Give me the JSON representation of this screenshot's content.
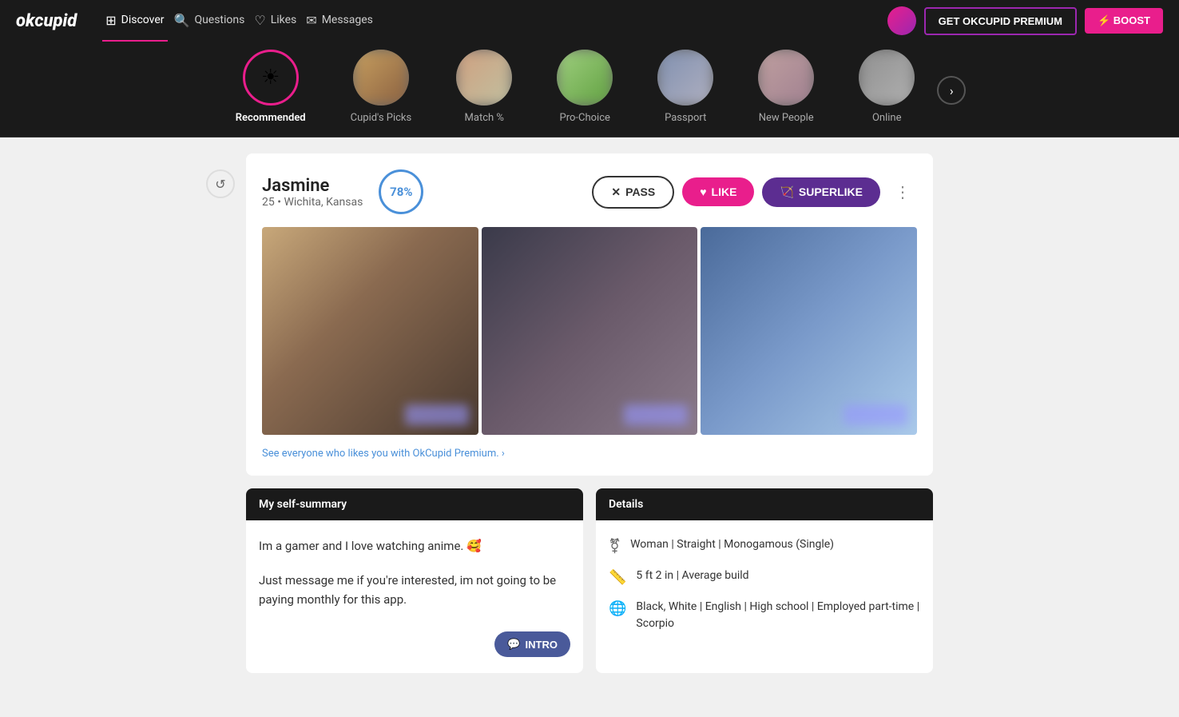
{
  "app": {
    "logo": "okcupid",
    "nav": [
      {
        "label": "Discover",
        "active": true,
        "icon": "⊞"
      },
      {
        "label": "Questions",
        "active": false,
        "icon": "?"
      },
      {
        "label": "Likes",
        "active": false,
        "icon": "♡"
      },
      {
        "label": "Messages",
        "active": false,
        "icon": "✉"
      }
    ],
    "premium_btn": "GET OKCUPID PREMIUM",
    "boost_btn": "⚡ BOOST"
  },
  "categories": [
    {
      "label": "Recommended",
      "active": true,
      "type": "icon"
    },
    {
      "label": "Cupid's Picks",
      "active": false,
      "type": "photo"
    },
    {
      "label": "Match %",
      "active": false,
      "type": "photo"
    },
    {
      "label": "Pro-Choice",
      "active": false,
      "type": "photo"
    },
    {
      "label": "Passport",
      "active": false,
      "type": "photo"
    },
    {
      "label": "New People",
      "active": false,
      "type": "photo"
    },
    {
      "label": "Online",
      "active": false,
      "type": "photo"
    }
  ],
  "profile": {
    "name": "Jasmine",
    "age": "25",
    "location": "Wichita, Kansas",
    "match_percent": "78%",
    "pass_label": "PASS",
    "like_label": "LIKE",
    "superlike_label": "SUPERLIKE"
  },
  "premium_prompt": "See everyone who likes you with OkCupid Premium. ›",
  "self_summary": {
    "header": "My self-summary",
    "text1": "Im a gamer and I love watching anime. 🥰",
    "text2": "Just message me if you're interested, im not going to be paying monthly for this app.",
    "intro_btn": "INTRO"
  },
  "details": {
    "header": "Details",
    "rows": [
      {
        "icon": "👤",
        "text": "Woman | Straight | Monogamous (Single)"
      },
      {
        "icon": "📏",
        "text": "5 ft 2 in | Average build"
      },
      {
        "icon": "🌐",
        "text": "Black, White | English | High school | Employed part-time | Scorpio"
      }
    ]
  }
}
